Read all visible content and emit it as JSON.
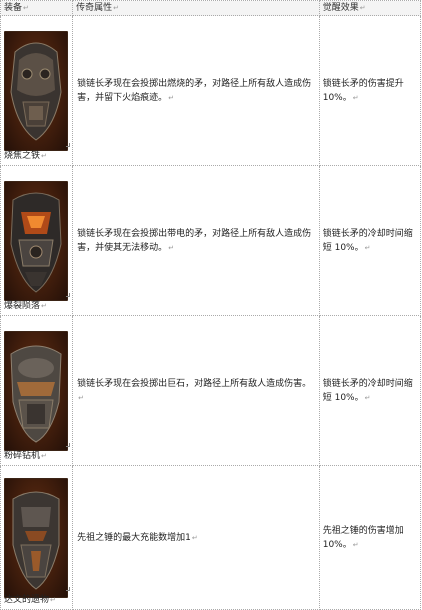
{
  "header": {
    "equipment": "装备",
    "legendary": "传奇属性",
    "awakening": "觉醒效果"
  },
  "rows": [
    {
      "name": "烧焦之铁",
      "legendary": "锁链长矛现在会投掷出燃烧的矛，对路径上所有敌人造成伤害，并留下火焰痕迹",
      "awakening": "锁链长矛的伤害提升 10%"
    },
    {
      "name": "爆裂陨落",
      "legendary": "锁链长矛现在会投掷出带电的矛，对路径上所有敌人造成伤害，并使其无法移动",
      "awakening": "锁链长矛的冷却时间缩短 10%"
    },
    {
      "name": "粉碎钻机",
      "legendary": "锁链长矛现在会投掷出巨石，对路径上所有敌人造成伤害",
      "awakening": "锁链长矛的冷却时间缩短 10%"
    },
    {
      "name": "达文的遗物",
      "legendary": "先祖之锤的最大充能数增加1",
      "awakening": "先祖之锤的伤害增加 10%"
    }
  ],
  "punct": {
    "period": "。",
    "ret": "↵"
  },
  "icons": [
    "armor-burnt-icon",
    "armor-burst-icon",
    "armor-shatter-icon",
    "armor-relic-icon"
  ]
}
